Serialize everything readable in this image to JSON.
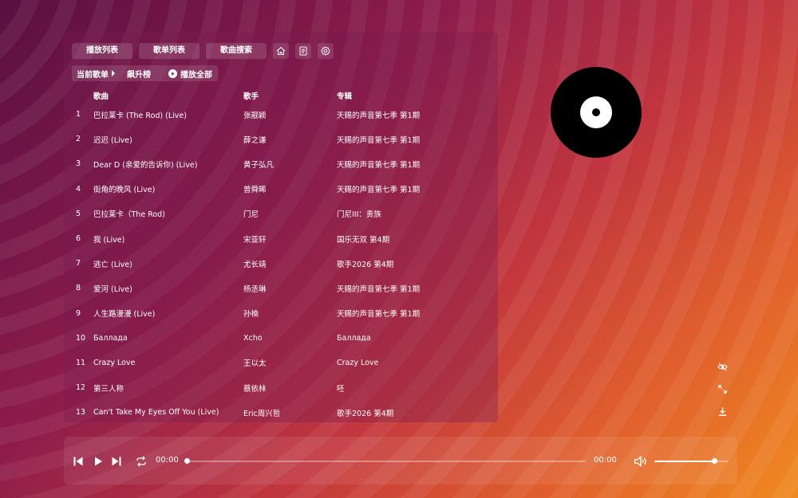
{
  "tabs": {
    "playlist": "播放列表",
    "songlist": "歌单列表",
    "search": "歌曲搜索"
  },
  "toolbar_icons": [
    "home-icon",
    "document-icon",
    "settings-icon"
  ],
  "crumb": {
    "current": "当前歌单",
    "name": "飙升榜",
    "play_all": "播放全部"
  },
  "table": {
    "headers": {
      "num": "",
      "song": "歌曲",
      "artist": "歌手",
      "album": "专辑"
    },
    "rows": [
      {
        "num": "1",
        "song": "巴拉莱卡 (The Rod) (Live)",
        "artist": "张靓颖",
        "album": "天赐的声音第七季 第1期"
      },
      {
        "num": "2",
        "song": "迟迟 (Live)",
        "artist": "薛之谦",
        "album": "天赐的声音第七季 第1期"
      },
      {
        "num": "3",
        "song": "Dear D (亲爱的告诉你) (Live)",
        "artist": "黄子弘凡",
        "album": "天赐的声音第七季 第1期"
      },
      {
        "num": "4",
        "song": "街角的晚风 (Live)",
        "artist": "曾舜晞",
        "album": "天赐的声音第七季 第1期"
      },
      {
        "num": "5",
        "song": "巴拉莱卡（The Rod)",
        "artist": "门尼",
        "album": "门尼III：贵族"
      },
      {
        "num": "6",
        "song": "我 (Live)",
        "artist": "宋亚轩",
        "album": "国乐无双 第4期"
      },
      {
        "num": "7",
        "song": "逃亡 (Live)",
        "artist": "尤长靖",
        "album": "歌手2026 第4期"
      },
      {
        "num": "8",
        "song": "爱河 (Live)",
        "artist": "杨丞琳",
        "album": "天赐的声音第七季 第1期"
      },
      {
        "num": "9",
        "song": "人生路漫漫 (Live)",
        "artist": "孙楠",
        "album": "天赐的声音第七季 第1期"
      },
      {
        "num": "10",
        "song": "Баллада",
        "artist": "Xcho",
        "album": "Баллада"
      },
      {
        "num": "11",
        "song": "Crazy Love",
        "artist": "王以太",
        "album": "Crazy Love"
      },
      {
        "num": "12",
        "song": "第三人称",
        "artist": "蔡依林",
        "album": "呸"
      },
      {
        "num": "13",
        "song": "Can't Take My Eyes Off You (Live)",
        "artist": "Eric周兴哲",
        "album": "歌手2026 第4期"
      }
    ]
  },
  "player": {
    "current_time": "00:00",
    "total_time": "00:00",
    "progress": 0,
    "volume": 0.81
  },
  "side_icons": [
    "eye-icon",
    "expand-icon",
    "download-icon"
  ],
  "colors": {
    "bg_start": "#5a1042",
    "bg_mid": "#c2363e",
    "bg_end": "#f08a20"
  }
}
